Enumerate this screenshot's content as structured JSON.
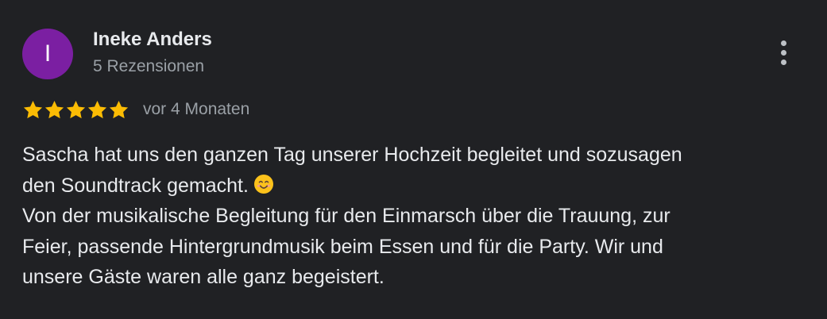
{
  "author": {
    "initial": "I",
    "name": "Ineke Anders",
    "meta": "5 Rezensionen",
    "avatar_color": "#7b1fa2"
  },
  "rating": {
    "stars": 5,
    "max_stars": 5,
    "star_color": "#fbbc04",
    "timestamp": "vor 4 Monaten"
  },
  "review": {
    "lines": [
      "Sascha hat uns den ganzen Tag unserer Hochzeit begleitet und sozusagen",
      "den Soundtrack gemacht.",
      "Von der musikalische Begleitung für den Einmarsch über die Trauung, zur",
      "Feier, passende Hintergrundmusik beim Essen und für die Party. Wir und",
      "unsere Gäste waren alle ganz begeistert."
    ],
    "emoji": "smiling-face-emoji"
  },
  "actions": {
    "more_icon": "more-vert-icon"
  },
  "colors": {
    "background": "#202124",
    "text_primary": "#e8eaed",
    "text_secondary": "#9aa0a6"
  }
}
